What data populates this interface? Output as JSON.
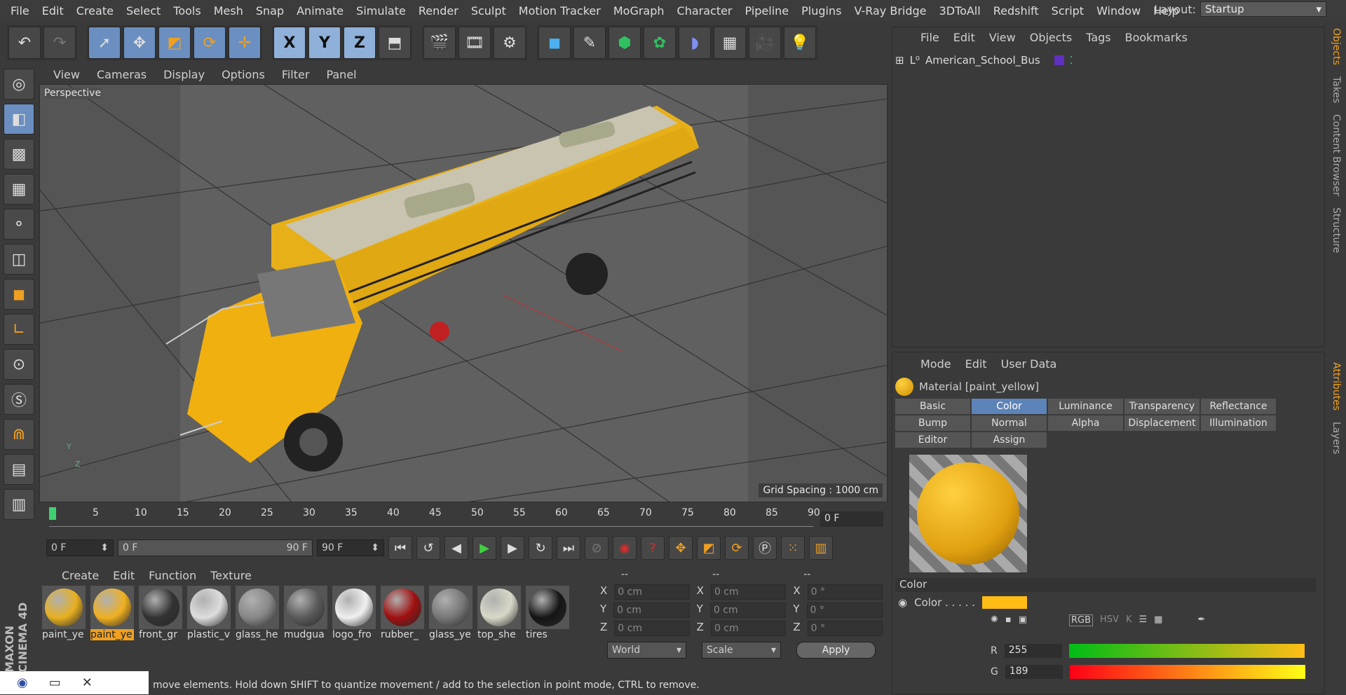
{
  "menubar": {
    "items": [
      "File",
      "Edit",
      "Create",
      "Select",
      "Tools",
      "Mesh",
      "Snap",
      "Animate",
      "Simulate",
      "Render",
      "Sculpt",
      "Motion Tracker",
      "MoGraph",
      "Character",
      "Pipeline",
      "Plugins",
      "V-Ray Bridge",
      "3DToAll",
      "Redshift",
      "Script",
      "Window",
      "Help"
    ],
    "layout_label": "Layout:",
    "layout_value": "Startup"
  },
  "axes": {
    "x": "X",
    "y": "Y",
    "z": "Z"
  },
  "viewport": {
    "menu": [
      "View",
      "Cameras",
      "Display",
      "Options",
      "Filter",
      "Panel"
    ],
    "label": "Perspective",
    "grid_spacing": "Grid Spacing : 1000 cm"
  },
  "timeline": {
    "ticks": [
      "0",
      "5",
      "10",
      "15",
      "20",
      "25",
      "30",
      "35",
      "40",
      "45",
      "50",
      "55",
      "60",
      "65",
      "70",
      "75",
      "80",
      "85",
      "90"
    ],
    "current_frame": "0 F"
  },
  "playback": {
    "start": "0 F",
    "range_start": "0 F",
    "range_end": "90 F",
    "end": "90 F"
  },
  "materials": {
    "menu": [
      "Create",
      "Edit",
      "Function",
      "Texture"
    ],
    "items": [
      {
        "name": "paint_ye",
        "color": "#e8b020"
      },
      {
        "name": "paint_ye",
        "color": "#f0b020",
        "selected": true
      },
      {
        "name": "front_gr",
        "color": "#333333"
      },
      {
        "name": "plastic_v",
        "color": "#dddddd"
      },
      {
        "name": "glass_he",
        "color": "#888888"
      },
      {
        "name": "mudgua",
        "color": "#5a5a5a"
      },
      {
        "name": "logo_fro",
        "color": "#f0f0f0"
      },
      {
        "name": "rubber_",
        "color": "#a01010"
      },
      {
        "name": "glass_ye",
        "color": "#777777"
      },
      {
        "name": "top_she",
        "color": "#d8d8c8"
      },
      {
        "name": "tires",
        "color": "#151515"
      }
    ]
  },
  "coords": {
    "headers": [
      "--",
      "--",
      "--"
    ],
    "rows": [
      [
        "X",
        "0 cm",
        "X",
        "0 cm",
        "X",
        "0 °"
      ],
      [
        "Y",
        "0 cm",
        "Y",
        "0 cm",
        "Y",
        "0 °"
      ],
      [
        "Z",
        "0 cm",
        "Z",
        "0 cm",
        "Z",
        "0 °"
      ]
    ],
    "world": "World",
    "scale": "Scale",
    "apply": "Apply"
  },
  "status": "move elements. Hold down SHIFT to quantize movement / add to the selection in point mode, CTRL to remove.",
  "objects": {
    "menu": [
      "File",
      "Edit",
      "View",
      "Objects",
      "Tags",
      "Bookmarks"
    ],
    "object_name": "American_School_Bus"
  },
  "attributes": {
    "menu": [
      "Mode",
      "Edit",
      "User Data"
    ],
    "title": "Material [paint_yellow]",
    "tabs": [
      "Basic",
      "Color",
      "Luminance",
      "Transparency",
      "Reflectance",
      "Bump",
      "Normal",
      "Alpha",
      "Displacement",
      "Illumination",
      "Editor",
      "Assign"
    ],
    "active_tab": "Color",
    "section": "Color",
    "color_label": "Color . . . . .",
    "color_value": "#ffbd16",
    "r_label": "R",
    "r": "255",
    "g_label": "G",
    "g": "189",
    "color_modes": [
      "RGB",
      "HSV",
      "K"
    ]
  },
  "sidetabs": [
    "Objects",
    "Takes",
    "Content Browser",
    "Structure",
    "Attributes",
    "Layers"
  ],
  "brand": "MAXON CINEMA 4D"
}
